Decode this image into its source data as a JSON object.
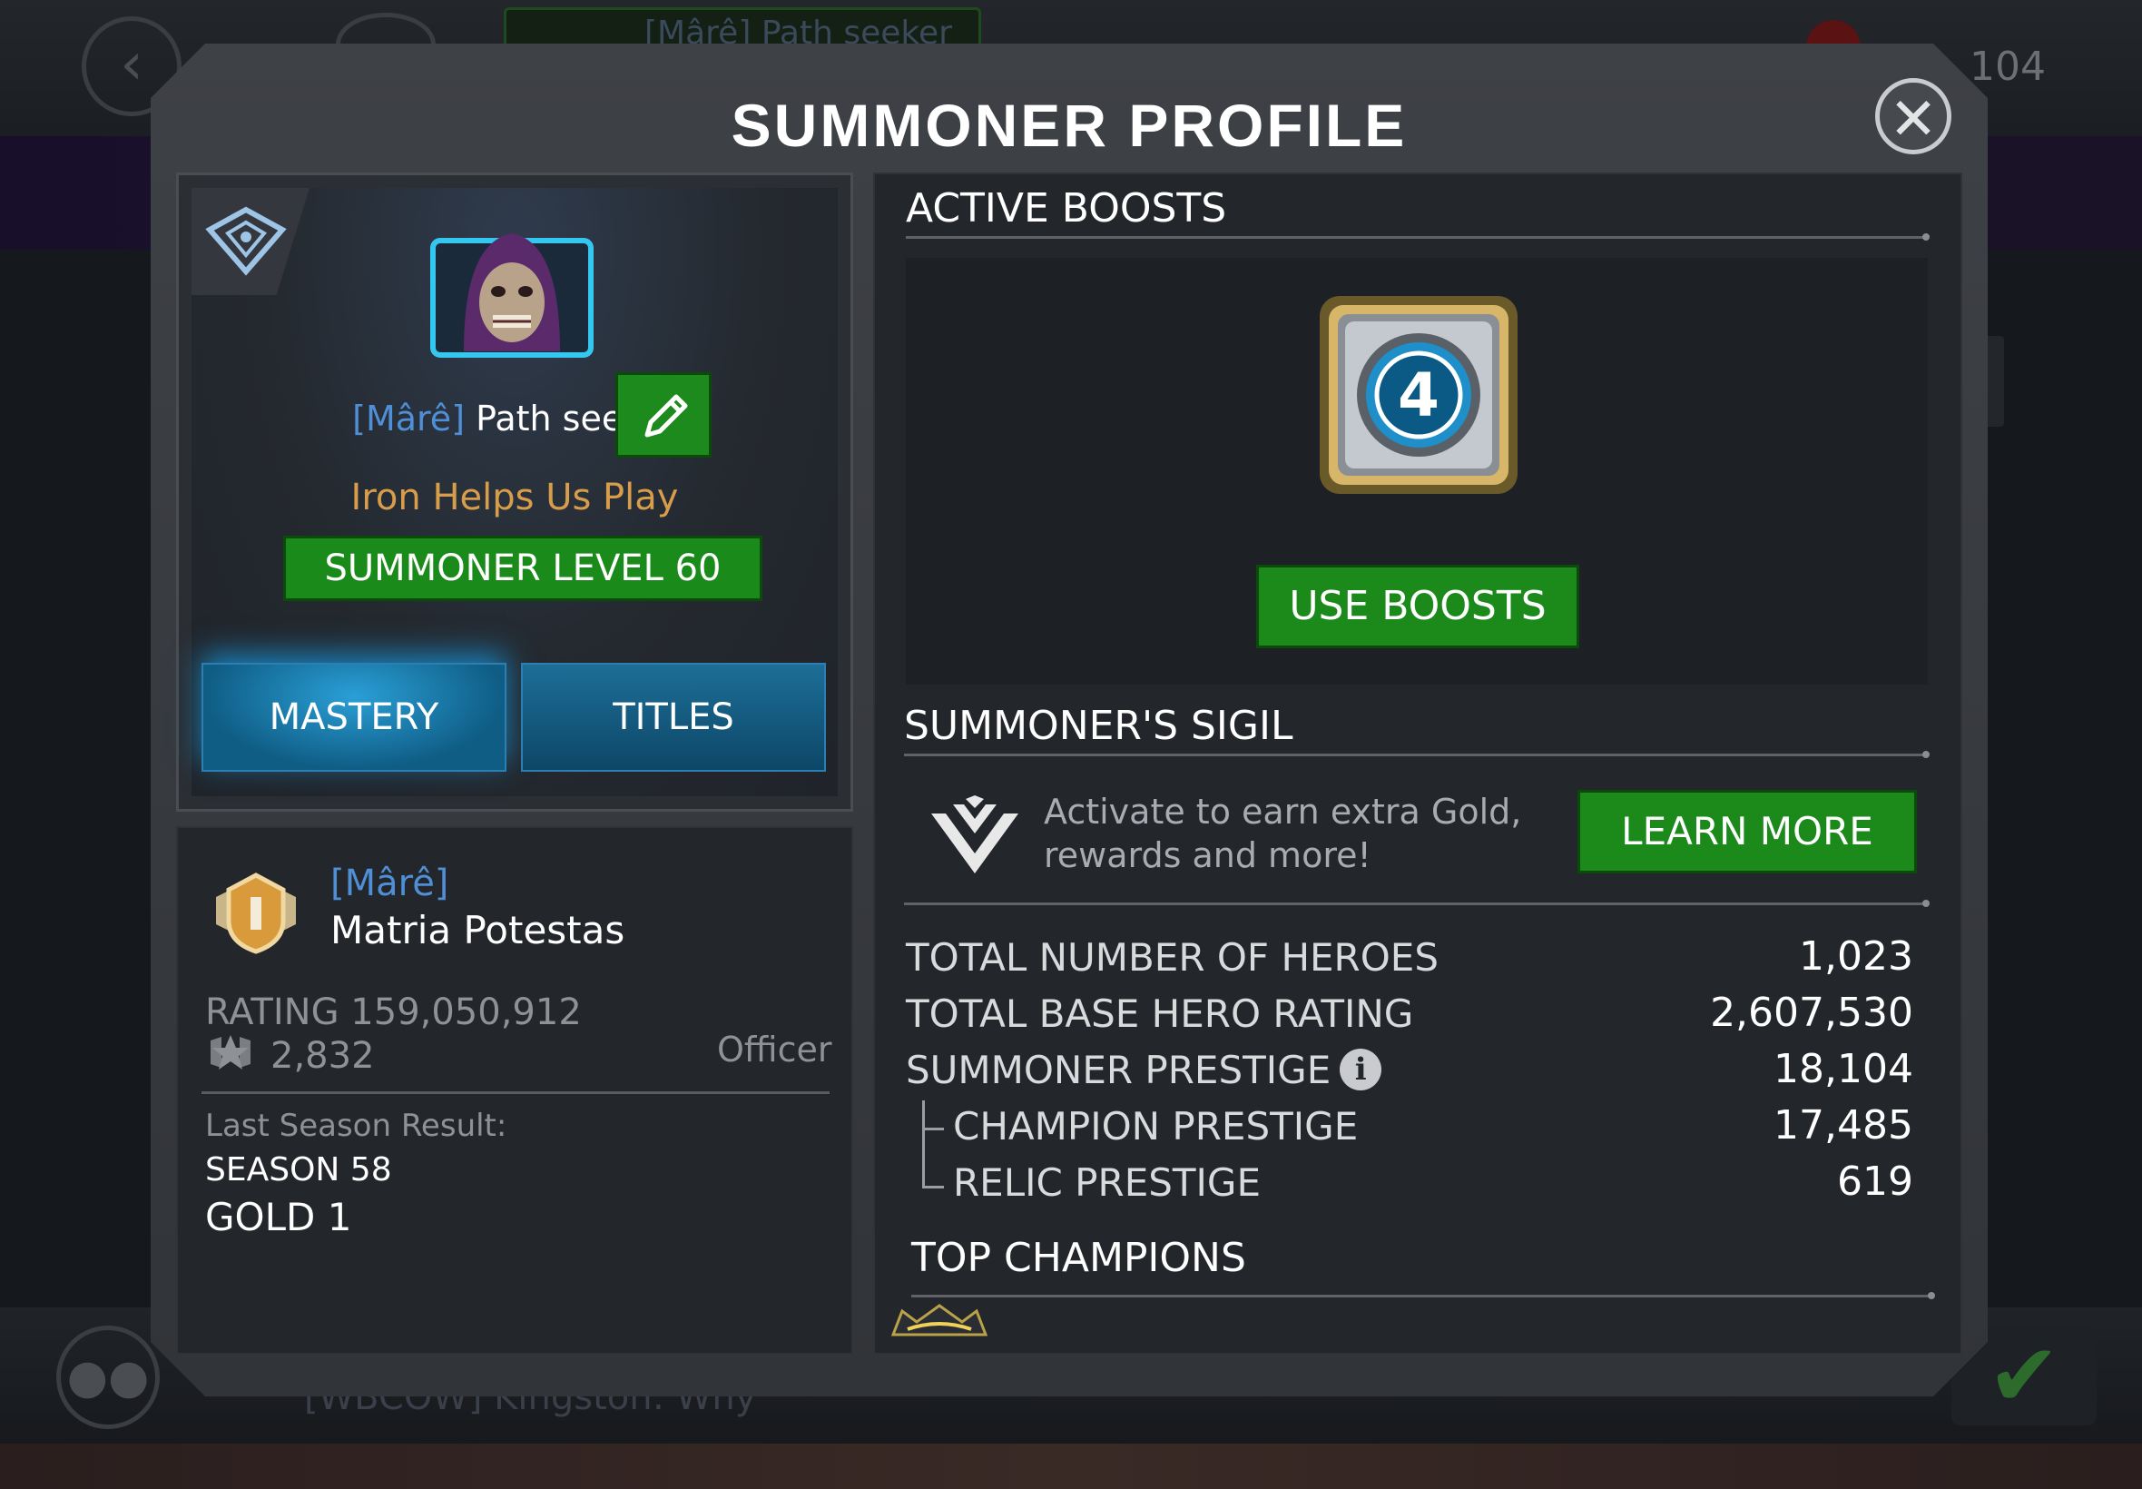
{
  "background": {
    "header_chip_text": "[Mârê] Path seeker",
    "header_counter": "104",
    "chat_preview": "[WBCOW] Kingston: Why"
  },
  "modal": {
    "title": "SUMMONER PROFILE",
    "close_icon": "close-x-icon"
  },
  "profile": {
    "crest_icon": "alliance-crest-icon",
    "avatar_icon": "hooded-villain-portrait",
    "alliance_tag": "[Mârê]",
    "name": "Path seeker",
    "edit_icon": "pencil-icon",
    "alliance_line": "Iron Helps Us Play",
    "level_label": "SUMMONER LEVEL 60",
    "tabs": [
      {
        "label": "MASTERY",
        "active": true
      },
      {
        "label": "TITLES",
        "active": false
      }
    ]
  },
  "alliance": {
    "badge_icon": "officer-badge-icon",
    "tag": "[Mârê]",
    "name": "Matria Potestas",
    "rating": "RATING 159,050,912",
    "trophy_icon": "war-trophy-icon",
    "trophies": "2,832",
    "rank": "Officer",
    "last_season_label": "Last Season Result:",
    "season": "SEASON 58",
    "tier": "GOLD 1"
  },
  "boosts": {
    "heading": "ACTIVE BOOSTS",
    "boost_icon": "fantastic-four-boost-icon",
    "use_label": "USE BOOSTS"
  },
  "sigil": {
    "heading": "SUMMONER'S SIGIL",
    "icon": "sigil-chevron-icon",
    "description": "Activate to earn extra Gold, rewards and more!",
    "learn_more": "LEARN MORE"
  },
  "stats": [
    {
      "label": "TOTAL NUMBER OF HEROES",
      "value": "1,023"
    },
    {
      "label": "TOTAL BASE HERO RATING",
      "value": "2,607,530"
    },
    {
      "label": "SUMMONER PRESTIGE",
      "value": "18,104",
      "info_icon": "info-icon"
    },
    {
      "label": "CHAMPION PRESTIGE",
      "value": "17,485"
    },
    {
      "label": "RELIC PRESTIGE",
      "value": "619"
    }
  ],
  "top_champions": {
    "heading": "TOP CHAMPIONS"
  },
  "colors": {
    "accent_green": "#1b8a1b",
    "accent_blue_tag": "#4f8fd6",
    "alliance_orange": "#d79d4a",
    "tab_blue": "#0f5d85"
  }
}
